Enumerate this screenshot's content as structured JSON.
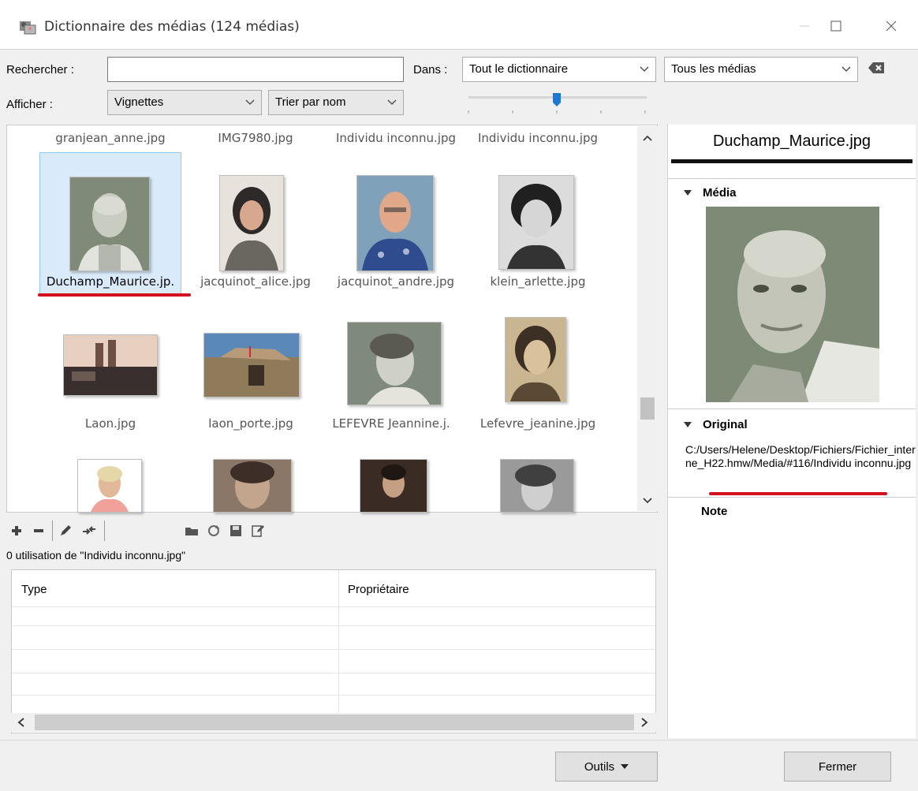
{
  "window": {
    "title": "Dictionnaire des médias (124 médias)",
    "icon": "media-dictionary-icon"
  },
  "search": {
    "label": "Rechercher :",
    "value": "",
    "placeholder": "",
    "in_label": "Dans :",
    "scope": "Tout le dictionnaire",
    "filter": "Tous les médias"
  },
  "display": {
    "label": "Afficher :",
    "mode": "Vignettes",
    "sort": "Trier par nom",
    "thumbnail_size_fraction": 0.5
  },
  "grid": {
    "top_row": [
      "granjean_anne.jpg",
      "IMG7980.jpg",
      "Individu inconnu.jpg",
      "Individu inconnu.jpg"
    ],
    "row1": [
      "Duchamp_Maurice.jp.",
      "jacquinot_alice.jpg",
      "jacquinot_andre.jpg",
      "klein_arlette.jpg"
    ],
    "row2": [
      "Laon.jpg",
      "laon_porte.jpg",
      "LEFEVRE Jeannine.j.",
      "Lefevre_jeanine.jpg"
    ],
    "selected": "Duchamp_Maurice.jp."
  },
  "usage": {
    "text": "0 utilisation de \"Individu inconnu.jpg\"",
    "columns": [
      "Type",
      "Propriétaire"
    ]
  },
  "details": {
    "title": "Duchamp_Maurice.jpg",
    "media_section": "Média",
    "original_section": "Original",
    "original_path": "C:/Users/Helene/Desktop/Fichiers/Fichier_interne_H22.hmw/Media/#116/Individu inconnu.jpg",
    "note_section": "Note"
  },
  "footer": {
    "tools_label": "Outils",
    "close_label": "Fermer"
  }
}
